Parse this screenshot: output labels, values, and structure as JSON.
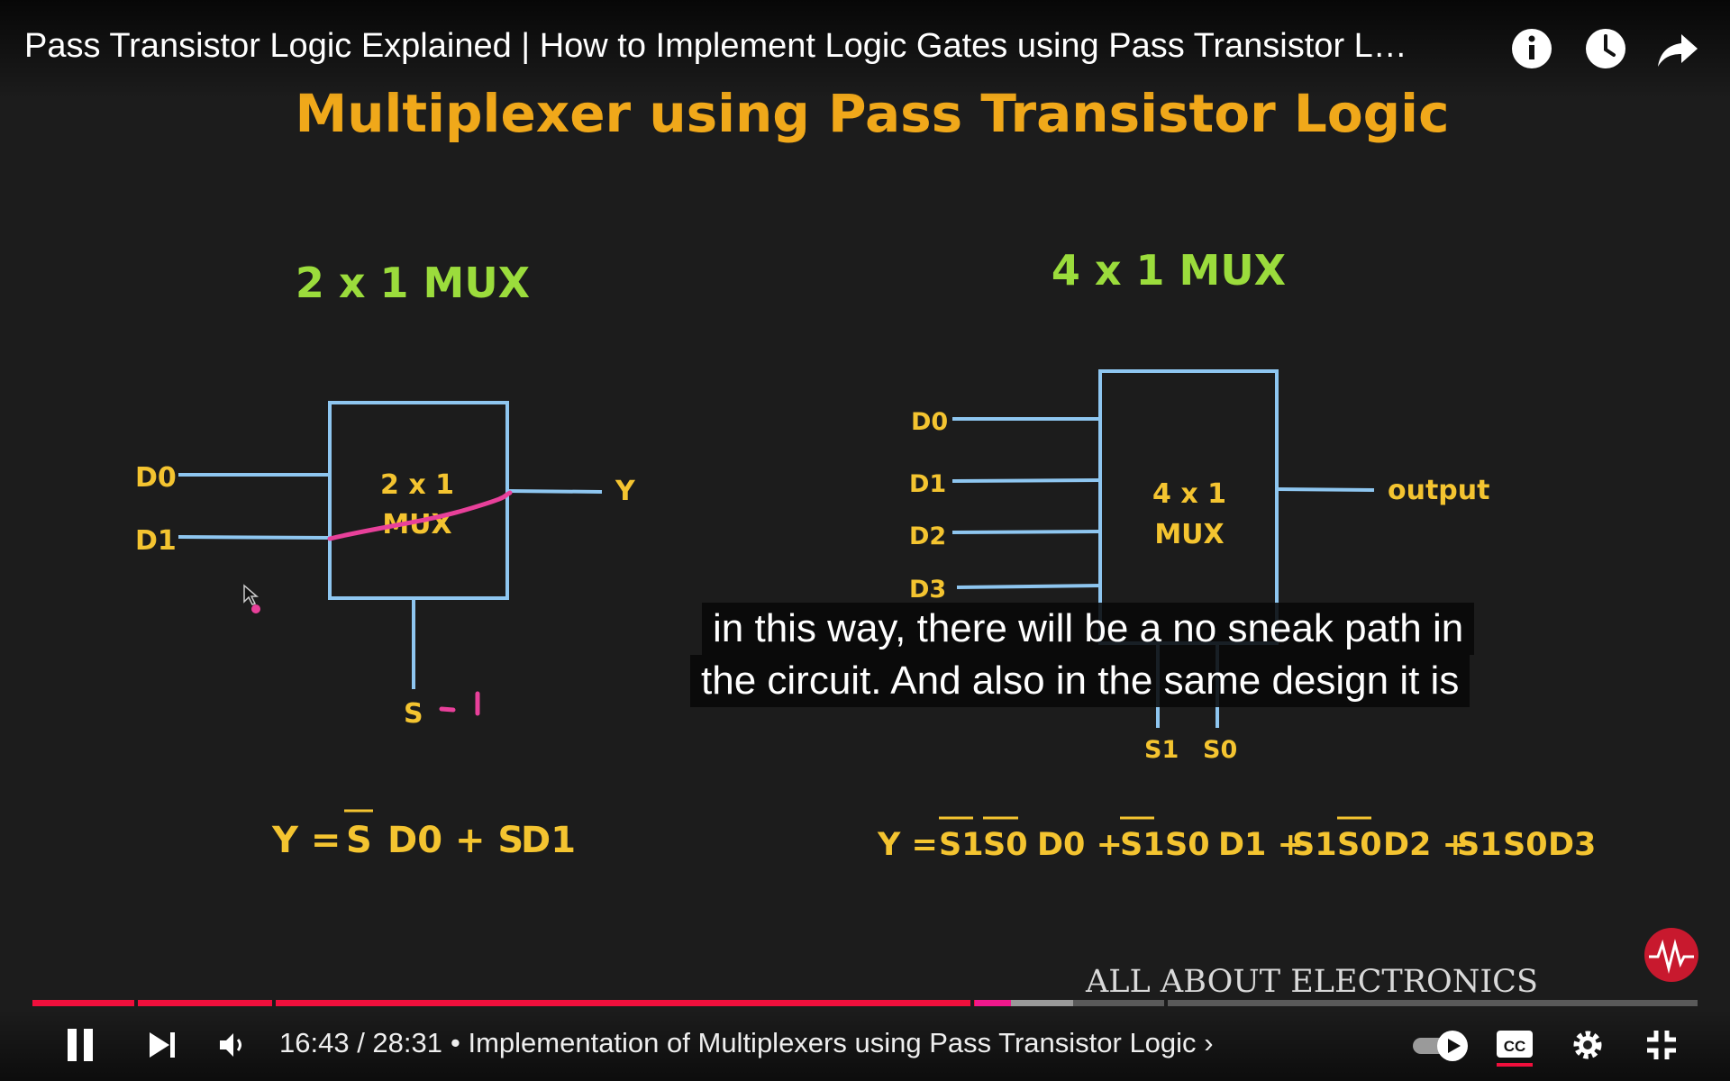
{
  "video_title": "Pass Transistor Logic Explained | How to Implement Logic Gates using Pass Transistor L…",
  "slide": {
    "title": "Multiplexer using Pass Transistor Logic",
    "mux2": {
      "heading": "2 x 1 MUX",
      "box_line1": "2 x 1",
      "box_line2": "MUX",
      "in0": "D0",
      "in1": "D1",
      "out": "Y",
      "sel": "S",
      "eq_y": "Y =",
      "eq_sbar": "S",
      "eq_rest1": "D0 + S",
      "eq_rest2": "D1"
    },
    "mux4": {
      "heading": "4 x 1 MUX",
      "box_line1": "4 x 1",
      "box_line2": "MUX",
      "in0": "D0",
      "in1": "D1",
      "in2": "D2",
      "in3": "D3",
      "out": "output",
      "sel1": "S1",
      "sel0": "S0",
      "eq": {
        "y": "Y =",
        "t1a": "S1",
        "t1b": "S0",
        "t1c": "D0 +",
        "t2a": "S1",
        "t2b": "S0",
        "t2c": "D1 +",
        "t3a": "S1",
        "t3b": "S0",
        "t3c": "D2 +",
        "t4a": "S1",
        "t4b": "S0",
        "t4c": "D3"
      }
    },
    "brand": "ALL ABOUT ELECTRONICS"
  },
  "captions": {
    "line1": "in this way, there will be a no sneak path in",
    "line2": "the circuit. And also in the same design it is"
  },
  "player": {
    "time": "16:43 / 28:31",
    "chapter": "• Implementation of Multiplexers using Pass Transistor Logic",
    "chapter_chevron": "›",
    "progress_played_fraction": 0.586,
    "progress_buffered_fraction": 0.625,
    "colors": {
      "played": "#f00f3c",
      "buffered": "#9a9a9a",
      "track": "#5a5a5a",
      "chapter_hover": "#f0188c"
    }
  },
  "icons": {
    "info": "info-icon",
    "watch_later": "clock-icon",
    "share": "share-icon",
    "pause": "pause-icon",
    "next": "next-icon",
    "volume": "volume-icon",
    "autoplay": "autoplay-toggle-icon",
    "captions": "cc-icon",
    "settings": "gear-icon",
    "exit_fullscreen": "exit-fullscreen-icon",
    "channel": "channel-logo-icon"
  }
}
